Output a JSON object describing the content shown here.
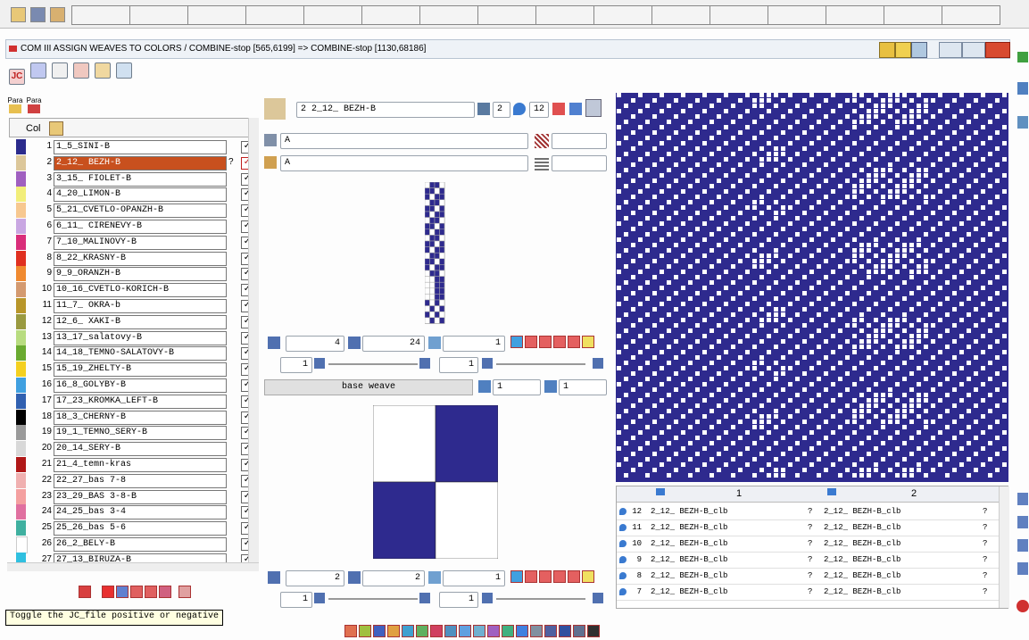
{
  "window_title": "COM III  ASSIGN WEAVES TO COLORS / COMBINE-stop [565,6199] => COMBINE-stop [1130,68186]",
  "left": {
    "para1": "Para",
    "para2": "Para",
    "col_header": "Col",
    "colors": [
      {
        "num": "1",
        "name": "1_5_SINI-B",
        "color": "#2b2b8c"
      },
      {
        "num": "2",
        "name": "2_12_ BEZH-B",
        "color": "#dcc79a",
        "selected": true,
        "mark": "?"
      },
      {
        "num": "3",
        "name": "3_15_ FIOLET-B",
        "color": "#a060c0"
      },
      {
        "num": "4",
        "name": "4_20_LIMON-B",
        "color": "#f2ee7a"
      },
      {
        "num": "5",
        "name": "5_21_CVETLO-OPANZH-B",
        "color": "#f7c890"
      },
      {
        "num": "6",
        "name": "6_11_ CIRENEVY-B",
        "color": "#c9a7e2"
      },
      {
        "num": "7",
        "name": "7_10_MALINOVY-B",
        "color": "#d92e7a"
      },
      {
        "num": "8",
        "name": "8_22_KRASNY-B",
        "color": "#e03020"
      },
      {
        "num": "9",
        "name": "9_9_ORANZH-B",
        "color": "#f08a30"
      },
      {
        "num": "10",
        "name": "10_16_CVETLO-KORICH-B",
        "color": "#d49a70"
      },
      {
        "num": "11",
        "name": "11_7_ OKRA-b",
        "color": "#b8962a"
      },
      {
        "num": "12",
        "name": "12_6_ XAKI-B",
        "color": "#9a9a40"
      },
      {
        "num": "13",
        "name": "13_17_salatovy-B",
        "color": "#b8dc80"
      },
      {
        "num": "14",
        "name": "14_18_TEMNO-SALATOVY-B",
        "color": "#6aaa30"
      },
      {
        "num": "15",
        "name": "15_19_ZHELTY-B",
        "color": "#f4d020"
      },
      {
        "num": "16",
        "name": "16_8_GOLYBY-B",
        "color": "#40a0e0"
      },
      {
        "num": "17",
        "name": "17_23_KROMKA_LEFT-B",
        "color": "#3060b0"
      },
      {
        "num": "18",
        "name": "18_3_CHERNY-B",
        "color": "#000000"
      },
      {
        "num": "19",
        "name": "19_1_TEMNO_SERY-B",
        "color": "#9a9a9a"
      },
      {
        "num": "20",
        "name": "20_14_SERY-B",
        "color": "#d8d8d8"
      },
      {
        "num": "21",
        "name": "21_4_temn-kras",
        "color": "#b01818"
      },
      {
        "num": "22",
        "name": "22_27_bas 7-8",
        "color": "#f0b0b0"
      },
      {
        "num": "23",
        "name": "23_29_BAS 3-8-B",
        "color": "#f4a0a0"
      },
      {
        "num": "24",
        "name": "24_25_bas 3-4",
        "color": "#e070a0"
      },
      {
        "num": "25",
        "name": "25_26_bas 5-6",
        "color": "#40b0a0"
      },
      {
        "num": "26",
        "name": "26_2_BELY-B",
        "color": "#ffffff"
      },
      {
        "num": "27",
        "name": "27_13_BIRUZA-B",
        "color": "#30c0e0"
      }
    ],
    "status_tip": "Toggle the JC_file positive or negative"
  },
  "middle": {
    "selected_color": "2 2_12_ BEZH-B",
    "count1": "2",
    "count2": "12",
    "field_a1": "A",
    "field_a2": "A",
    "repeat_x": "4",
    "repeat_y": "24",
    "field_1": "1",
    "slider1": "1",
    "slider2": "1",
    "base_weave_label": "base weave",
    "bw_a": "1",
    "bw_b": "1",
    "bw_repeat_x": "2",
    "bw_repeat_y": "2",
    "bw_field_1": "1",
    "bw_slider1": "1",
    "bw_slider2": "1"
  },
  "right_table": {
    "col1": "1",
    "col2": "2",
    "rows": [
      {
        "n": "12",
        "a": "2_12_ BEZH-B_clb",
        "b": "2_12_ BEZH-B_clb"
      },
      {
        "n": "11",
        "a": "2_12_ BEZH-B_clb",
        "b": "2_12_ BEZH-B_clb"
      },
      {
        "n": "10",
        "a": "2_12_ BEZH-B_clb",
        "b": "2_12_ BEZH-B_clb"
      },
      {
        "n": "9",
        "a": "2_12_ BEZH-B_clb",
        "b": "2_12_ BEZH-B_clb"
      },
      {
        "n": "8",
        "a": "2_12_ BEZH-B_clb",
        "b": "2_12_ BEZH-B_clb"
      },
      {
        "n": "7",
        "a": "2_12_ BEZH-B_clb",
        "b": "2_12_ BEZH-B_clb"
      }
    ],
    "q": "?"
  },
  "colors": {
    "weave_blue": "#2e2a8e",
    "selected_row": "#c8501e",
    "title_bar": "#eef2f7"
  }
}
